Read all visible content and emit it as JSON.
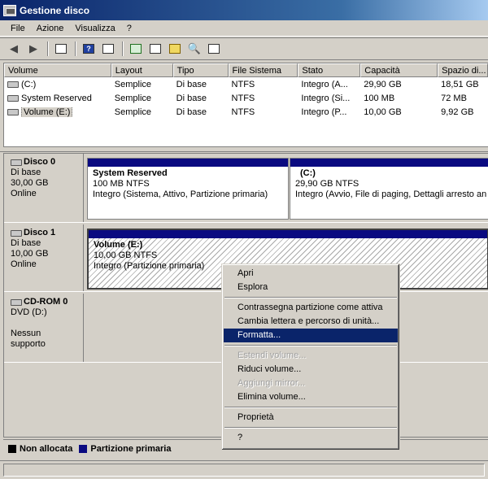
{
  "window": {
    "title": "Gestione disco"
  },
  "menubar": [
    "File",
    "Azione",
    "Visualizza",
    "?"
  ],
  "toolbar": {
    "icons": [
      "back-arrow-icon",
      "forward-arrow-icon",
      "console-tree-icon",
      "help-icon",
      "properties-icon",
      "refresh-icon",
      "export-icon",
      "open-icon",
      "search-icon",
      "settings-icon"
    ]
  },
  "volumes": {
    "columns": [
      "Volume",
      "Layout",
      "Tipo",
      "File Sistema",
      "Stato",
      "Capacità",
      "Spazio di..."
    ],
    "rows": [
      [
        "(C:)",
        "Semplice",
        "Di base",
        "NTFS",
        "Integro (A...",
        "29,90 GB",
        "18,51 GB"
      ],
      [
        "System Reserved",
        "Semplice",
        "Di base",
        "NTFS",
        "Integro (Si...",
        "100 MB",
        "72 MB"
      ],
      [
        "Volume (E:)",
        "Semplice",
        "Di base",
        "NTFS",
        "Integro (P...",
        "10,00 GB",
        "9,92 GB"
      ]
    ]
  },
  "disks": [
    {
      "name": "Disco 0",
      "type": "Di base",
      "size": "30,00 GB",
      "status": "Online",
      "partitions": [
        {
          "name": "System Reserved",
          "size": "100 MB NTFS",
          "status": "Integro (Sistema, Attivo, Partizione primaria)"
        },
        {
          "name": "(C:)",
          "size": "29,90 GB NTFS",
          "status": "Integro (Avvio, File di paging, Dettagli arresto an"
        }
      ]
    },
    {
      "name": "Disco 1",
      "type": "Di base",
      "size": "10,00 GB",
      "status": "Online",
      "partitions": [
        {
          "name": "Volume  (E:)",
          "size": "10,00 GB NTFS",
          "status": "Integro (Partizione primaria)"
        }
      ]
    },
    {
      "name": "CD-ROM 0",
      "type": "DVD (D:)",
      "size": "",
      "status": "Nessun supporto"
    }
  ],
  "legend": [
    {
      "label": "Non allocata",
      "color": "#000000"
    },
    {
      "label": "Partizione primaria",
      "color": "#0a0a80"
    }
  ],
  "context_menu": {
    "items": [
      {
        "label": "Apri",
        "enabled": true
      },
      {
        "label": "Esplora",
        "enabled": true
      },
      {
        "label": "Contrassegna partizione come attiva",
        "enabled": true
      },
      {
        "label": "Cambia lettera e percorso di unità...",
        "enabled": true
      },
      {
        "label": "Formatta...",
        "enabled": true,
        "highlighted": true
      },
      {
        "label": "Estendi volume...",
        "enabled": false
      },
      {
        "label": "Riduci volume...",
        "enabled": true
      },
      {
        "label": "Aggiungi mirror...",
        "enabled": false
      },
      {
        "label": "Elimina volume...",
        "enabled": true
      },
      {
        "label": "Proprietà",
        "enabled": true
      },
      {
        "label": "?",
        "enabled": true
      }
    ]
  }
}
